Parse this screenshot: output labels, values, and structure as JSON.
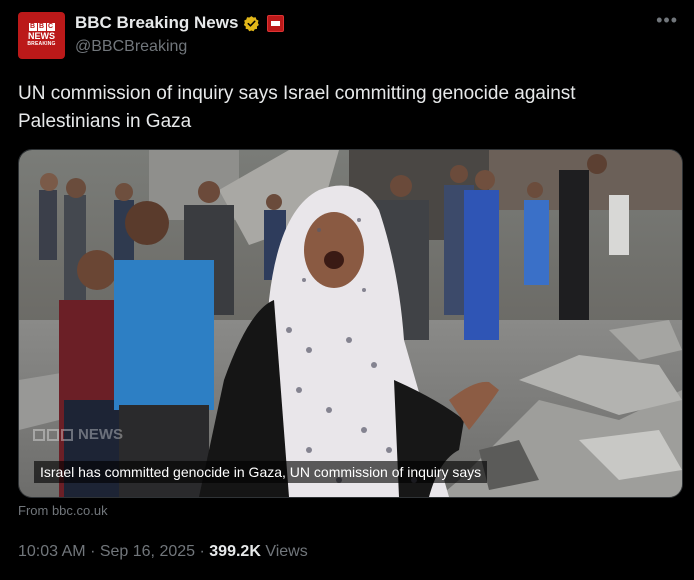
{
  "tweet": {
    "avatar": {
      "bbc": [
        "B",
        "B",
        "C"
      ],
      "news": "NEWS",
      "breaking": "BREAKING"
    },
    "display_name": "BBC Breaking News",
    "handle": "@BBCBreaking",
    "more_icon": "more-horizontal-icon",
    "text": "UN commission of inquiry says Israel committing genocide against Palestinians in Gaza",
    "media": {
      "caption": "Israel has committed genocide in Gaza, UN commission of inquiry says",
      "watermark": "NEWS"
    },
    "source": "From bbc.co.uk",
    "time": "10:03 AM",
    "date": "Sep 16, 2025",
    "views_count": "399.2K",
    "views_label": "Views",
    "separator": "·"
  },
  "colors": {
    "background": "#000000",
    "text_primary": "#e7e9ea",
    "text_secondary": "#71767b",
    "bbc_red": "#bb1919",
    "verified_gold": "#e2b719"
  }
}
